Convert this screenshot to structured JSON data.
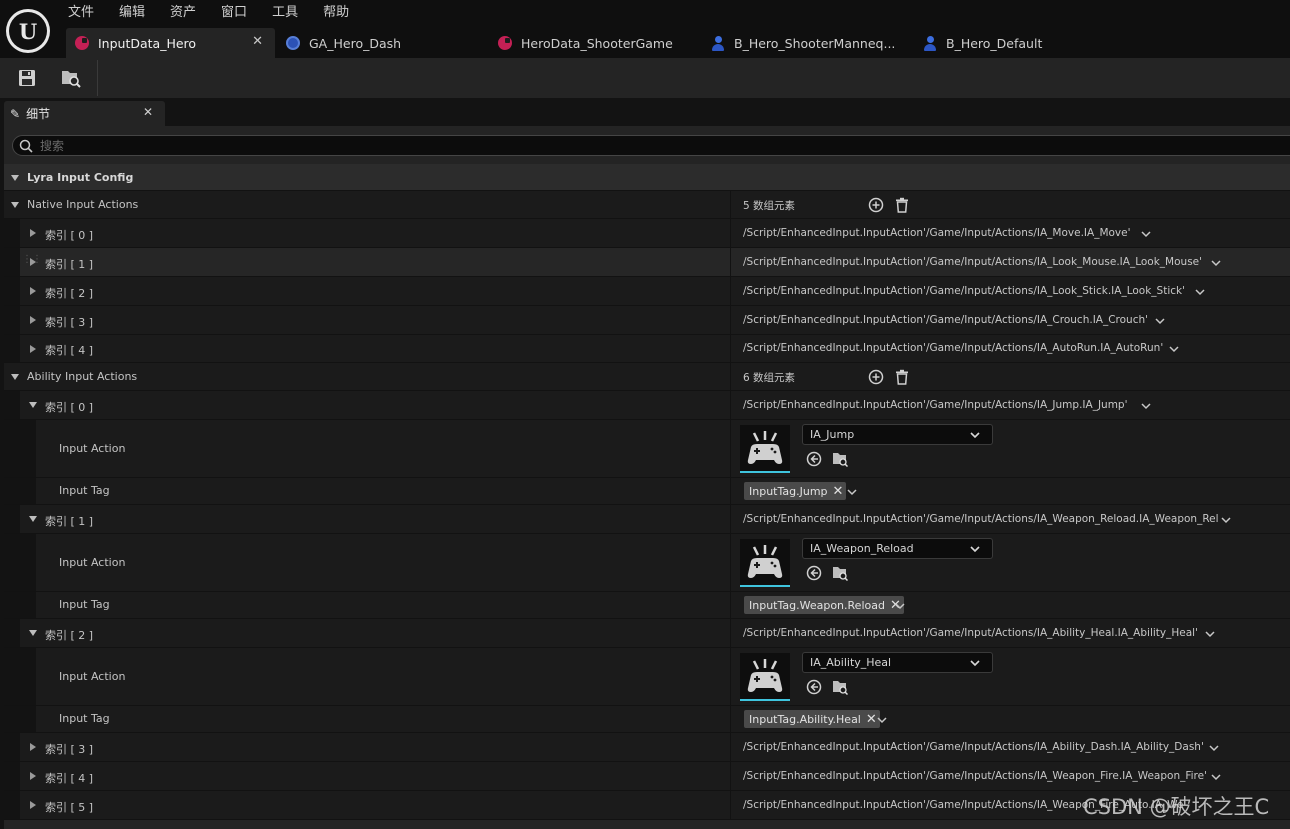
{
  "menu": [
    "文件",
    "编辑",
    "资产",
    "窗口",
    "工具",
    "帮助"
  ],
  "tabs": [
    {
      "label": "InputData_Hero",
      "icon": "data-asset-icon",
      "active": true
    },
    {
      "label": "GA_Hero_Dash",
      "icon": "blueprint-icon",
      "active": false
    },
    {
      "label": "HeroData_ShooterGame",
      "icon": "data-asset-icon",
      "active": false
    },
    {
      "label": "B_Hero_ShooterManneq...",
      "icon": "character-icon",
      "active": false
    },
    {
      "label": "B_Hero_Default",
      "icon": "character-icon",
      "active": false
    }
  ],
  "toolbar": {
    "save": "save-icon",
    "browse": "browse-icon"
  },
  "panel": {
    "tab_label": "细节",
    "search_placeholder": "搜索"
  },
  "category": "Lyra Input Config",
  "native": {
    "label": "Native Input Actions",
    "count": "5 数组元素",
    "items": [
      {
        "index": "索引 [ 0 ]",
        "value": "/Script/EnhancedInput.InputAction'/Game/Input/Actions/IA_Move.IA_Move'"
      },
      {
        "index": "索引 [ 1 ]",
        "value": "/Script/EnhancedInput.InputAction'/Game/Input/Actions/IA_Look_Mouse.IA_Look_Mouse'"
      },
      {
        "index": "索引 [ 2 ]",
        "value": "/Script/EnhancedInput.InputAction'/Game/Input/Actions/IA_Look_Stick.IA_Look_Stick'"
      },
      {
        "index": "索引 [ 3 ]",
        "value": "/Script/EnhancedInput.InputAction'/Game/Input/Actions/IA_Crouch.IA_Crouch'"
      },
      {
        "index": "索引 [ 4 ]",
        "value": "/Script/EnhancedInput.InputAction'/Game/Input/Actions/IA_AutoRun.IA_AutoRun'"
      }
    ]
  },
  "ability": {
    "label": "Ability Input Actions",
    "count": "6 数组元素",
    "expanded": [
      {
        "index": "索引 [ 0 ]",
        "value": "/Script/EnhancedInput.InputAction'/Game/Input/Actions/IA_Jump.IA_Jump'",
        "action_label": "Input Action",
        "action": "IA_Jump",
        "tag_label": "Input Tag",
        "tag": "InputTag.Jump"
      },
      {
        "index": "索引 [ 1 ]",
        "value": "/Script/EnhancedInput.InputAction'/Game/Input/Actions/IA_Weapon_Reload.IA_Weapon_Rel",
        "action_label": "Input Action",
        "action": "IA_Weapon_Reload",
        "tag_label": "Input Tag",
        "tag": "InputTag.Weapon.Reload"
      },
      {
        "index": "索引 [ 2 ]",
        "value": "/Script/EnhancedInput.InputAction'/Game/Input/Actions/IA_Ability_Heal.IA_Ability_Heal'",
        "action_label": "Input Action",
        "action": "IA_Ability_Heal",
        "tag_label": "Input Tag",
        "tag": "InputTag.Ability.Heal"
      }
    ],
    "collapsed": [
      {
        "index": "索引 [ 3 ]",
        "value": "/Script/EnhancedInput.InputAction'/Game/Input/Actions/IA_Ability_Dash.IA_Ability_Dash'"
      },
      {
        "index": "索引 [ 4 ]",
        "value": "/Script/EnhancedInput.InputAction'/Game/Input/Actions/IA_Weapon_Fire.IA_Weapon_Fire'"
      },
      {
        "index": "索引 [ 5 ]",
        "value": "/Script/EnhancedInput.InputAction'/Game/Input/Actions/IA_Weapon_Fire_Auto.IA_Weapon_F"
      }
    ]
  },
  "watermark": "CSDN @破坏之王C",
  "colors": {
    "accent_cyan": "#3fc4de",
    "data_asset": "#c42055",
    "blueprint": "#2c52b6",
    "character": "#3c6ee0"
  }
}
